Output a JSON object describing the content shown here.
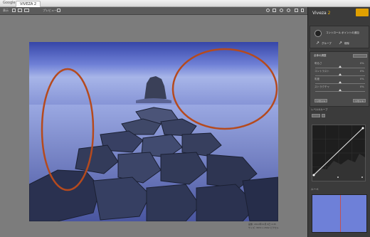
{
  "browser": {
    "brand": "Google",
    "tab_title": "VIVEZA 2"
  },
  "toolbar": {
    "view_label": "表示",
    "preview_label": "プレビュー"
  },
  "panel": {
    "brand_name": "Viveza",
    "brand_version": "2",
    "control_point_label": "コントロール ポイントの追加",
    "group_label": "グループ",
    "delete_label": "削除",
    "global_adjust_label": "全体の調整",
    "brightness_label": "明るさ",
    "contrast_label": "コントラスト",
    "saturation_label": "彩度",
    "structure_label": "ストラクチャ",
    "brightness_value": "0%",
    "contrast_value": "0%",
    "saturation_value": "0%",
    "structure_value": "0%",
    "reset_label": "リセット",
    "curve_title": "レベル&カーブ",
    "loupe_title": "ルーペ",
    "accent_color": "#e0a000"
  },
  "caption": {
    "line1": "画像: 2010年11月 6日 4:45",
    "line2": "サイズ: 3872 x 2592 ピクセル"
  },
  "annotations": {
    "ellipse_color": "#b54a1e"
  }
}
